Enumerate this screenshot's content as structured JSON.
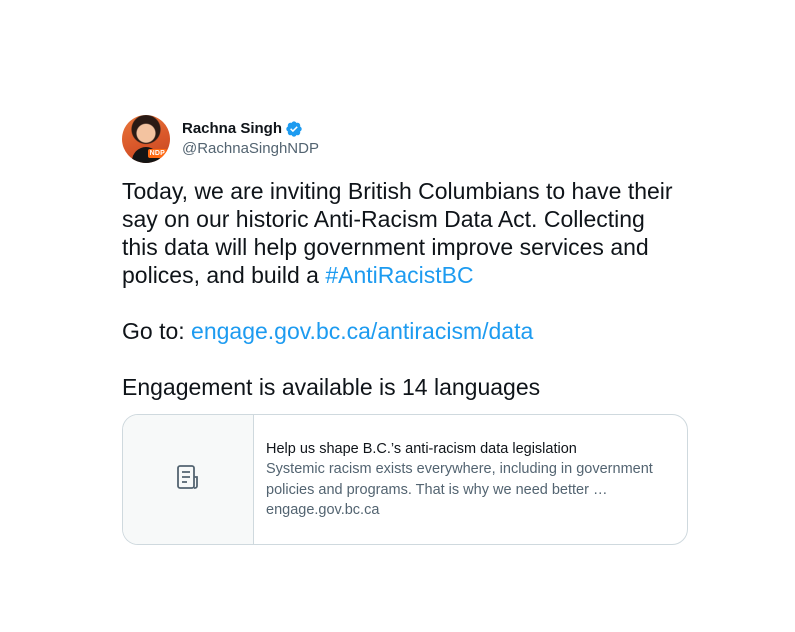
{
  "tweet": {
    "author": {
      "name": "Rachna Singh",
      "handle": "@RachnaSinghNDP",
      "avatar_badge": "NDP",
      "verified": true
    },
    "text_lines": [
      "Today, we are inviting British Columbians to have their",
      "say on our historic Anti-Racism Data Act. Collecting",
      "this data will help government improve services and"
    ],
    "line4_prefix": "polices, and build a ",
    "hashtag": "#AntiRacistBC",
    "goto_prefix": "Go to: ",
    "goto_link": "engage.gov.bc.ca/antiracism/data",
    "engagement_line": "Engagement is available is 14 languages",
    "card": {
      "icon": "document-icon",
      "title": "Help us shape B.C.’s anti-racism data legislation",
      "description_line1": "Systemic racism exists everywhere, including in government",
      "description_line2": "policies and programs. That is why we need better …",
      "domain": "engage.gov.bc.ca"
    }
  },
  "colors": {
    "link": "#1d9bf0",
    "verified": "#1d9bf0",
    "secondary_text": "#536471",
    "border": "#cfd9de"
  }
}
